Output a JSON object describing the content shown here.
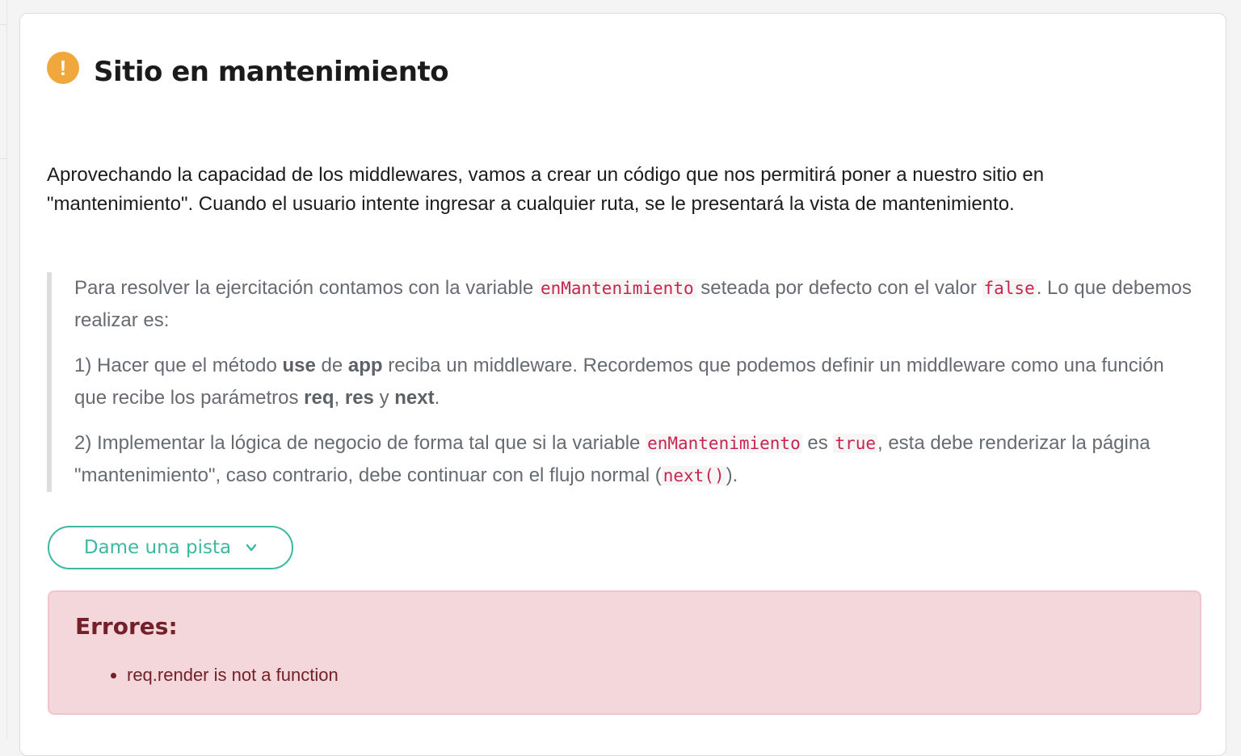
{
  "header": {
    "icon": "exclamation-circle-icon",
    "icon_glyph": "!",
    "icon_color": "#f0a83c",
    "title": "Sitio en mantenimiento"
  },
  "intro": {
    "text": "Aprovechando la capacidad de los middlewares, vamos a crear un código que nos permitirá poner a nuestro sitio en \"mantenimiento\". Cuando el usuario intente ingresar a cualquier ruta, se le presentará la vista de mantenimiento."
  },
  "quote": {
    "p1": {
      "a": "Para resolver la ejercitación contamos con la variable ",
      "code1": "enMantenimiento",
      "b": " seteada por defecto con el valor ",
      "code2": "false",
      "c": ". Lo que debemos realizar es:"
    },
    "p2": {
      "a": "1) Hacer que el método ",
      "b1": "use",
      "b": " de ",
      "b2": "app",
      "c": " reciba un middleware. Recordemos que podemos definir un middleware como una función que recibe los parámetros ",
      "b3": "req",
      "d": ", ",
      "b4": "res",
      "e": " y ",
      "b5": "next",
      "f": "."
    },
    "p3": {
      "a": "2) Implementar la lógica de negocio de forma tal que si la variable ",
      "code1": "enMantenimiento",
      "b": " es ",
      "code2": "true",
      "c": ", esta debe renderizar la página \"mantenimiento\", caso contrario, debe continuar con el flujo normal (",
      "code3": "next()",
      "d": ")."
    }
  },
  "hint_button": {
    "label": "Dame una pista",
    "icon": "chevron-down-icon",
    "color": "#3db8a1"
  },
  "errors": {
    "title": "Errores:",
    "items": [
      "req.render is not a function"
    ],
    "background": "#f3d7da",
    "text_color": "#73202a"
  }
}
